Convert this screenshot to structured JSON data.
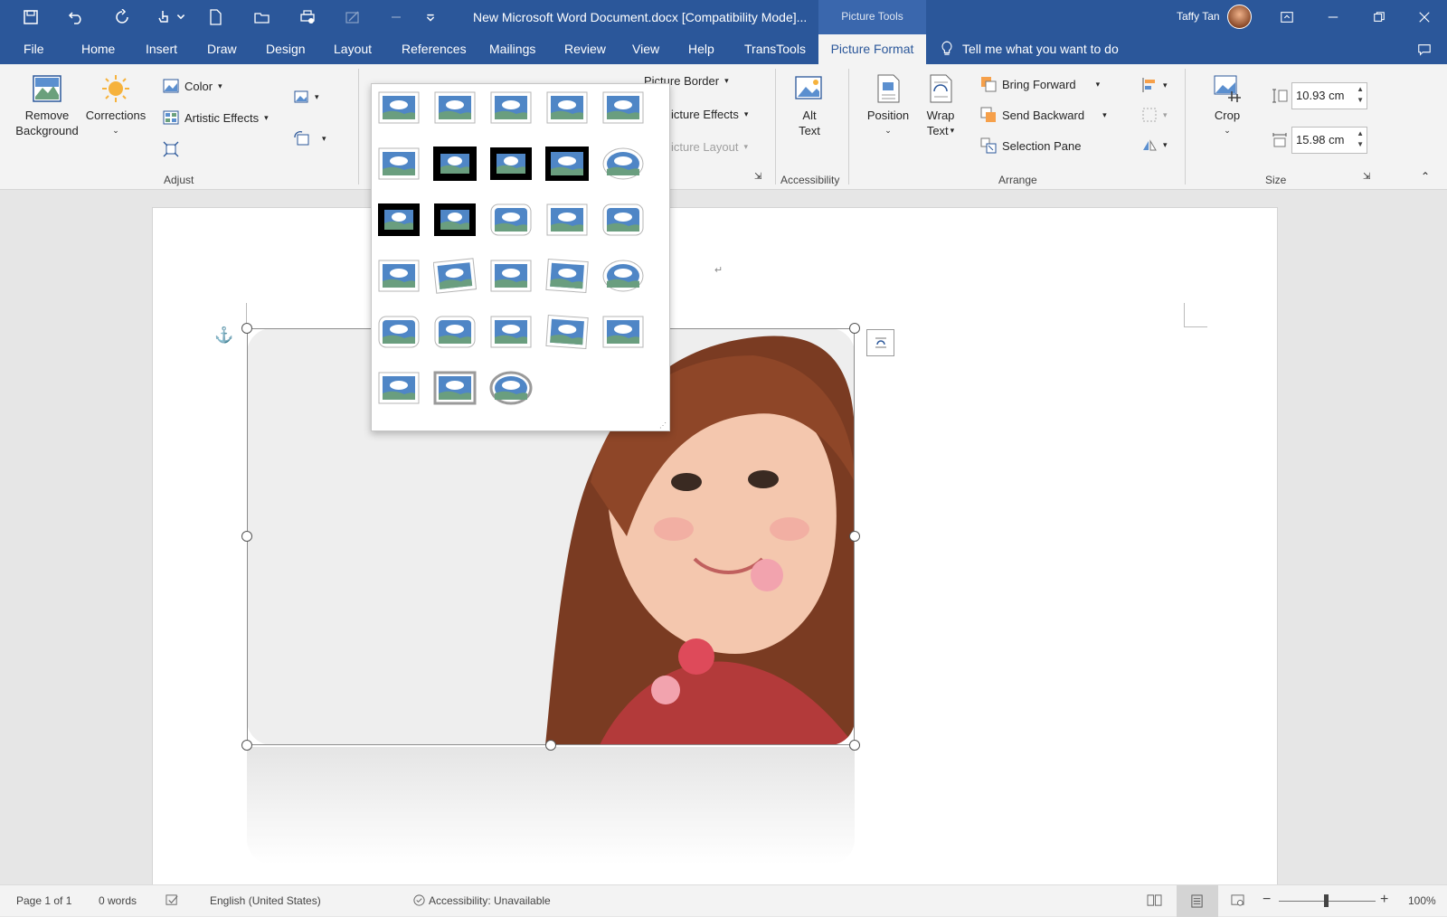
{
  "window": {
    "title": "New Microsoft Word Document.docx [Compatibility Mode]...",
    "context_label": "Picture Tools",
    "user_name": "Taffy Tan"
  },
  "tabs": {
    "file": "File",
    "home": "Home",
    "insert": "Insert",
    "draw": "Draw",
    "design": "Design",
    "layout": "Layout",
    "references": "References",
    "mailings": "Mailings",
    "review": "Review",
    "view": "View",
    "help": "Help",
    "transtools": "TransTools",
    "picture_format": "Picture Format",
    "tell_me": "Tell me what you want to do"
  },
  "ribbon": {
    "remove_bg_1": "Remove",
    "remove_bg_2": "Background",
    "corrections": "Corrections",
    "color": "Color",
    "artistic_effects": "Artistic Effects",
    "adjust_label": "Adjust",
    "picture_border": "Picture Border",
    "picture_effects": "icture Effects",
    "picture_layout": "icture Layout",
    "alt_text_1": "Alt",
    "alt_text_2": "Text",
    "accessibility_label": "Accessibility",
    "position": "Position",
    "wrap_text_1": "Wrap",
    "wrap_text_2": "Text",
    "bring_forward": "Bring Forward",
    "send_backward": "Send Backward",
    "selection_pane": "Selection Pane",
    "arrange_label": "Arrange",
    "crop": "Crop",
    "height_value": "10.93 cm",
    "width_value": "15.98 cm",
    "size_label": "Size"
  },
  "status": {
    "page": "Page 1 of 1",
    "words": "0 words",
    "language": "English (United States)",
    "accessibility": "Accessibility: Unavailable",
    "zoom": "100%"
  },
  "colors": {
    "brand_blue": "#2b579a",
    "ribbon_bg": "#f3f3f3"
  }
}
